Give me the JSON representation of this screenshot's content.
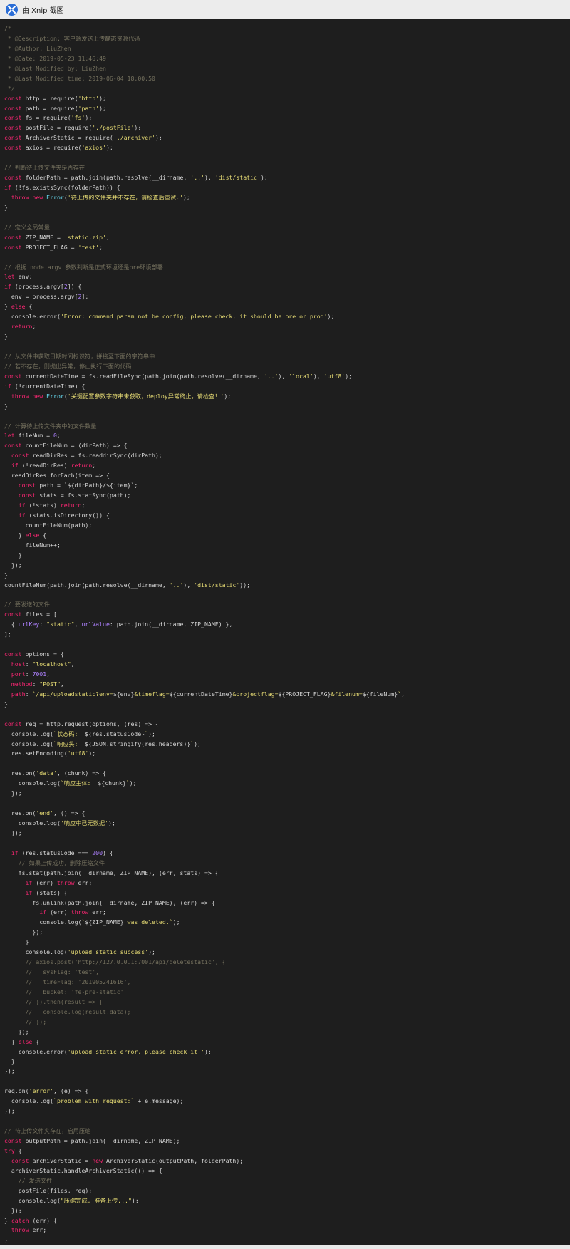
{
  "window": {
    "title": "由 Xnip 截图"
  },
  "code_lines": [
    [
      [
        "c",
        "/*"
      ]
    ],
    [
      [
        "c",
        " * @Description: 客户端发送上传静态资源代码"
      ]
    ],
    [
      [
        "c",
        " * @Author: LiuZhen"
      ]
    ],
    [
      [
        "c",
        " * @Date: 2019-05-23 11:46:49"
      ]
    ],
    [
      [
        "c",
        " * @Last Modified by: LiuZhen"
      ]
    ],
    [
      [
        "c",
        " * @Last Modified time: 2019-06-04 18:00:50"
      ]
    ],
    [
      [
        "c",
        " */"
      ]
    ],
    [
      [
        "k",
        "const"
      ],
      [
        "p",
        " http = require("
      ],
      [
        "s",
        "'http'"
      ],
      [
        "p",
        ");"
      ]
    ],
    [
      [
        "k",
        "const"
      ],
      [
        "p",
        " path = require("
      ],
      [
        "s",
        "'path'"
      ],
      [
        "p",
        ");"
      ]
    ],
    [
      [
        "k",
        "const"
      ],
      [
        "p",
        " fs = require("
      ],
      [
        "s",
        "'fs'"
      ],
      [
        "p",
        ");"
      ]
    ],
    [
      [
        "k",
        "const"
      ],
      [
        "p",
        " postFile = require("
      ],
      [
        "s",
        "'./postFile'"
      ],
      [
        "p",
        ");"
      ]
    ],
    [
      [
        "k",
        "const"
      ],
      [
        "p",
        " ArchiverStatic = require("
      ],
      [
        "s",
        "'./archiver'"
      ],
      [
        "p",
        ");"
      ]
    ],
    [
      [
        "k",
        "const"
      ],
      [
        "p",
        " axios = require("
      ],
      [
        "s",
        "'axios'"
      ],
      [
        "p",
        ");"
      ]
    ],
    [],
    [
      [
        "c",
        "// 判断待上传文件夹是否存在"
      ]
    ],
    [
      [
        "k",
        "const"
      ],
      [
        "p",
        " folderPath = path.join(path.resolve(__dirname, "
      ],
      [
        "s",
        "'..'"
      ],
      [
        "p",
        "), "
      ],
      [
        "s",
        "'dist/static'"
      ],
      [
        "p",
        ");"
      ]
    ],
    [
      [
        "k",
        "if"
      ],
      [
        "p",
        " (!fs.existsSync(folderPath)) {"
      ]
    ],
    [
      [
        "p",
        "  "
      ],
      [
        "k",
        "throw new"
      ],
      [
        "p",
        " "
      ],
      [
        "f",
        "Error"
      ],
      [
        "p",
        "("
      ],
      [
        "s",
        "'待上传的文件夹并不存在，请检查后重试.'"
      ],
      [
        "p",
        ");"
      ]
    ],
    [
      [
        "p",
        "}"
      ]
    ],
    [],
    [
      [
        "c",
        "// 定义全局常量"
      ]
    ],
    [
      [
        "k",
        "const"
      ],
      [
        "p",
        " ZIP_NAME = "
      ],
      [
        "s",
        "'static.zip'"
      ],
      [
        "p",
        ";"
      ]
    ],
    [
      [
        "k",
        "const"
      ],
      [
        "p",
        " PROJECT_FLAG = "
      ],
      [
        "s",
        "'test'"
      ],
      [
        "p",
        ";"
      ]
    ],
    [],
    [
      [
        "c",
        "// 根据 node argv 参数判断是正式环境还是pre环境部署"
      ]
    ],
    [
      [
        "k",
        "let"
      ],
      [
        "p",
        " env;"
      ]
    ],
    [
      [
        "k",
        "if"
      ],
      [
        "p",
        " (process.argv["
      ],
      [
        "n",
        "2"
      ],
      [
        "p",
        "]) {"
      ]
    ],
    [
      [
        "p",
        "  env = process.argv["
      ],
      [
        "n",
        "2"
      ],
      [
        "p",
        "];"
      ]
    ],
    [
      [
        "p",
        "} "
      ],
      [
        "k",
        "else"
      ],
      [
        "p",
        " {"
      ]
    ],
    [
      [
        "p",
        "  console.error("
      ],
      [
        "s",
        "'Error: command param not be config, please check, it should be pre or prod'"
      ],
      [
        "p",
        ");"
      ]
    ],
    [
      [
        "p",
        "  "
      ],
      [
        "k",
        "return"
      ],
      [
        "p",
        ";"
      ]
    ],
    [
      [
        "p",
        "}"
      ]
    ],
    [],
    [
      [
        "c",
        "// 从文件中获取日期时间标识符，拼接至下面的字符串中"
      ]
    ],
    [
      [
        "c",
        "// 若不存在，则抛出异常，停止执行下面的代码"
      ]
    ],
    [
      [
        "k",
        "const"
      ],
      [
        "p",
        " currentDateTime = fs.readFileSync(path.join(path.resolve(__dirname, "
      ],
      [
        "s",
        "'..'"
      ],
      [
        "p",
        "), "
      ],
      [
        "s",
        "'local'"
      ],
      [
        "p",
        "), "
      ],
      [
        "s",
        "'utf8'"
      ],
      [
        "p",
        ");"
      ]
    ],
    [
      [
        "k",
        "if"
      ],
      [
        "p",
        " (!currentDateTime) {"
      ]
    ],
    [
      [
        "p",
        "  "
      ],
      [
        "k",
        "throw new"
      ],
      [
        "p",
        " "
      ],
      [
        "f",
        "Error"
      ],
      [
        "p",
        "("
      ],
      [
        "s",
        "'关键配置参数字符串未获取，deploy异常终止，请检查！'"
      ],
      [
        "p",
        ");"
      ]
    ],
    [
      [
        "p",
        "}"
      ]
    ],
    [],
    [
      [
        "c",
        "// 计算待上传文件夹中的文件数量"
      ]
    ],
    [
      [
        "k",
        "let"
      ],
      [
        "p",
        " fileNum = "
      ],
      [
        "n",
        "0"
      ],
      [
        "p",
        ";"
      ]
    ],
    [
      [
        "k",
        "const"
      ],
      [
        "p",
        " countFileNum = (dirPath) => {"
      ]
    ],
    [
      [
        "p",
        "  "
      ],
      [
        "k",
        "const"
      ],
      [
        "p",
        " readDirRes = fs.readdirSync(dirPath);"
      ]
    ],
    [
      [
        "p",
        "  "
      ],
      [
        "k",
        "if"
      ],
      [
        "p",
        " (!readDirRes) "
      ],
      [
        "k",
        "return"
      ],
      [
        "p",
        ";"
      ]
    ],
    [
      [
        "p",
        "  readDirRes.forEach(item => {"
      ]
    ],
    [
      [
        "p",
        "    "
      ],
      [
        "k",
        "const"
      ],
      [
        "p",
        " path = `${dirPath}/${item}`;"
      ]
    ],
    [
      [
        "p",
        "    "
      ],
      [
        "k",
        "const"
      ],
      [
        "p",
        " stats = fs.statSync(path);"
      ]
    ],
    [
      [
        "p",
        "    "
      ],
      [
        "k",
        "if"
      ],
      [
        "p",
        " (!stats) "
      ],
      [
        "k",
        "return"
      ],
      [
        "p",
        ";"
      ]
    ],
    [
      [
        "p",
        "    "
      ],
      [
        "k",
        "if"
      ],
      [
        "p",
        " (stats.isDirectory()) {"
      ]
    ],
    [
      [
        "p",
        "      countFileNum(path);"
      ]
    ],
    [
      [
        "p",
        "    } "
      ],
      [
        "k",
        "else"
      ],
      [
        "p",
        " {"
      ]
    ],
    [
      [
        "p",
        "      fileNum++;"
      ]
    ],
    [
      [
        "p",
        "    }"
      ]
    ],
    [
      [
        "p",
        "  });"
      ]
    ],
    [
      [
        "p",
        "}"
      ]
    ],
    [
      [
        "p",
        "countFileNum(path.join(path.resolve(__dirname, "
      ],
      [
        "s",
        "'..'"
      ],
      [
        "p",
        "), "
      ],
      [
        "s",
        "'dist/static'"
      ],
      [
        "p",
        "));"
      ]
    ],
    [],
    [
      [
        "c",
        "// 要发送的文件"
      ]
    ],
    [
      [
        "k",
        "const"
      ],
      [
        "p",
        " files = ["
      ]
    ],
    [
      [
        "p",
        "  { "
      ],
      [
        "n",
        "urlKey"
      ],
      [
        "p",
        ": "
      ],
      [
        "s",
        "\"static\""
      ],
      [
        "p",
        ", "
      ],
      [
        "n",
        "urlValue"
      ],
      [
        "p",
        ": path.join(__dirname, ZIP_NAME) },"
      ]
    ],
    [
      [
        "p",
        "];"
      ]
    ],
    [],
    [
      [
        "k",
        "const"
      ],
      [
        "p",
        " options = {"
      ]
    ],
    [
      [
        "p",
        "  "
      ],
      [
        "k",
        "host"
      ],
      [
        "p",
        ": "
      ],
      [
        "s",
        "\"localhost\""
      ],
      [
        "p",
        ","
      ]
    ],
    [
      [
        "p",
        "  "
      ],
      [
        "k",
        "port"
      ],
      [
        "p",
        ": "
      ],
      [
        "n",
        "7001"
      ],
      [
        "p",
        ","
      ]
    ],
    [
      [
        "p",
        "  "
      ],
      [
        "k",
        "method"
      ],
      [
        "p",
        ": "
      ],
      [
        "s",
        "\"POST\""
      ],
      [
        "p",
        ","
      ]
    ],
    [
      [
        "p",
        "  "
      ],
      [
        "k",
        "path"
      ],
      [
        "p",
        ": "
      ],
      [
        "s",
        "`/api/uploadstatic?env="
      ],
      [
        "p",
        "${env}"
      ],
      [
        "s",
        "&timeflag="
      ],
      [
        "p",
        "${currentDateTime}"
      ],
      [
        "s",
        "&projectflag="
      ],
      [
        "p",
        "${PROJECT_FLAG}"
      ],
      [
        "s",
        "&filenum="
      ],
      [
        "p",
        "${fileNum}"
      ],
      [
        "s",
        "`"
      ],
      [
        "p",
        ","
      ]
    ],
    [
      [
        "p",
        "}"
      ]
    ],
    [],
    [
      [
        "k",
        "const"
      ],
      [
        "p",
        " req = http.request(options, (res) => {"
      ]
    ],
    [
      [
        "p",
        "  console.log("
      ],
      [
        "s",
        "`状态码:  "
      ],
      [
        "p",
        "${res.statusCode}"
      ],
      [
        "s",
        "`"
      ],
      [
        "p",
        ");"
      ]
    ],
    [
      [
        "p",
        "  console.log("
      ],
      [
        "s",
        "`响应头:  "
      ],
      [
        "p",
        "${JSON.stringify(res.headers)}"
      ],
      [
        "s",
        "`"
      ],
      [
        "p",
        ");"
      ]
    ],
    [
      [
        "p",
        "  res.setEncoding("
      ],
      [
        "s",
        "'utf8'"
      ],
      [
        "p",
        ");"
      ]
    ],
    [],
    [
      [
        "p",
        "  res.on("
      ],
      [
        "s",
        "'data'"
      ],
      [
        "p",
        ", (chunk) => {"
      ]
    ],
    [
      [
        "p",
        "    console.log("
      ],
      [
        "s",
        "`响应主体:  "
      ],
      [
        "p",
        "${chunk}"
      ],
      [
        "s",
        "`"
      ],
      [
        "p",
        ");"
      ]
    ],
    [
      [
        "p",
        "  });"
      ]
    ],
    [],
    [
      [
        "p",
        "  res.on("
      ],
      [
        "s",
        "'end'"
      ],
      [
        "p",
        ", () => {"
      ]
    ],
    [
      [
        "p",
        "    console.log("
      ],
      [
        "s",
        "'响应中已无数据'"
      ],
      [
        "p",
        ");"
      ]
    ],
    [
      [
        "p",
        "  });"
      ]
    ],
    [],
    [
      [
        "p",
        "  "
      ],
      [
        "k",
        "if"
      ],
      [
        "p",
        " (res.statusCode === "
      ],
      [
        "n",
        "200"
      ],
      [
        "p",
        ") {"
      ]
    ],
    [
      [
        "c",
        "    // 如果上传成功，删除压缩文件"
      ]
    ],
    [
      [
        "p",
        "    fs.stat(path.join(__dirname, ZIP_NAME), (err, stats) => {"
      ]
    ],
    [
      [
        "p",
        "      "
      ],
      [
        "k",
        "if"
      ],
      [
        "p",
        " (err) "
      ],
      [
        "k",
        "throw"
      ],
      [
        "p",
        " err;"
      ]
    ],
    [
      [
        "p",
        "      "
      ],
      [
        "k",
        "if"
      ],
      [
        "p",
        " (stats) {"
      ]
    ],
    [
      [
        "p",
        "        fs.unlink(path.join(__dirname, ZIP_NAME), (err) => {"
      ]
    ],
    [
      [
        "p",
        "          "
      ],
      [
        "k",
        "if"
      ],
      [
        "p",
        " (err) "
      ],
      [
        "k",
        "throw"
      ],
      [
        "p",
        " err;"
      ]
    ],
    [
      [
        "p",
        "          console.log("
      ],
      [
        "s",
        "`"
      ],
      [
        "p",
        "${ZIP_NAME}"
      ],
      [
        "s",
        " was deleted.`"
      ],
      [
        "p",
        ");"
      ]
    ],
    [
      [
        "p",
        "        });"
      ]
    ],
    [
      [
        "p",
        "      }"
      ]
    ],
    [
      [
        "p",
        "      console.log("
      ],
      [
        "s",
        "'upload static success'"
      ],
      [
        "p",
        ");"
      ]
    ],
    [
      [
        "c",
        "      // axios.post('http://127.0.0.1:7001/api/deletestatic', {"
      ]
    ],
    [
      [
        "c",
        "      //   sysFlag: 'test',"
      ]
    ],
    [
      [
        "c",
        "      //   timeFlag: '201905241616',"
      ]
    ],
    [
      [
        "c",
        "      //   bucket: 'fe-pre-static'"
      ]
    ],
    [
      [
        "c",
        "      // }).then(result => {"
      ]
    ],
    [
      [
        "c",
        "      //   console.log(result.data);"
      ]
    ],
    [
      [
        "c",
        "      // });"
      ]
    ],
    [
      [
        "p",
        "    });"
      ]
    ],
    [
      [
        "p",
        "  } "
      ],
      [
        "k",
        "else"
      ],
      [
        "p",
        " {"
      ]
    ],
    [
      [
        "p",
        "    console.error("
      ],
      [
        "s",
        "'upload static error, please check it!'"
      ],
      [
        "p",
        ");"
      ]
    ],
    [
      [
        "p",
        "  }"
      ]
    ],
    [
      [
        "p",
        "});"
      ]
    ],
    [],
    [
      [
        "p",
        "req.on("
      ],
      [
        "s",
        "'error'"
      ],
      [
        "p",
        ", (e) => {"
      ]
    ],
    [
      [
        "p",
        "  console.log("
      ],
      [
        "s",
        "`problem with request:`"
      ],
      [
        "p",
        " + e.message);"
      ]
    ],
    [
      [
        "p",
        "});"
      ]
    ],
    [],
    [
      [
        "c",
        "// 待上传文件夹存在，启用压缩"
      ]
    ],
    [
      [
        "k",
        "const"
      ],
      [
        "p",
        " outputPath = path.join(__dirname, ZIP_NAME);"
      ]
    ],
    [
      [
        "k",
        "try"
      ],
      [
        "p",
        " {"
      ]
    ],
    [
      [
        "p",
        "  "
      ],
      [
        "k",
        "const"
      ],
      [
        "p",
        " archiverStatic = "
      ],
      [
        "k",
        "new"
      ],
      [
        "p",
        " ArchiverStatic(outputPath, folderPath);"
      ]
    ],
    [
      [
        "p",
        "  archiverStatic.handleArchiverStatic(() => {"
      ]
    ],
    [
      [
        "c",
        "    // 发送文件"
      ]
    ],
    [
      [
        "p",
        "    postFile(files, req);"
      ]
    ],
    [
      [
        "p",
        "    console.log("
      ],
      [
        "s",
        "\"压缩完成, 准备上传...\""
      ],
      [
        "p",
        ");"
      ]
    ],
    [
      [
        "p",
        "  });"
      ]
    ],
    [
      [
        "p",
        "} "
      ],
      [
        "k",
        "catch"
      ],
      [
        "p",
        " (err) {"
      ]
    ],
    [
      [
        "p",
        "  "
      ],
      [
        "k",
        "throw"
      ],
      [
        "p",
        " err;"
      ]
    ],
    [
      [
        "p",
        "}"
      ]
    ]
  ]
}
